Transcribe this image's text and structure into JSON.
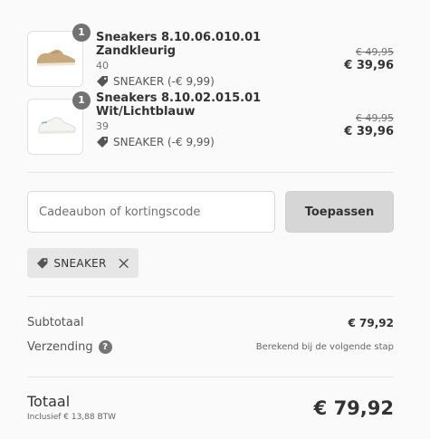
{
  "cart": {
    "items": [
      {
        "quantity": "1",
        "name": "Sneakers 8.10.06.010.01 Zandkleurig",
        "size": "40",
        "discount": "SNEAKER (-€ 9,99)",
        "price_old": "€ 49,95",
        "price_new": "€ 39,96",
        "image_color": "#c8a97e"
      },
      {
        "quantity": "1",
        "name": "Sneakers 8.10.02.015.01 Wit/Lichtblauw",
        "size": "39",
        "discount": "SNEAKER (-€ 9,99)",
        "price_old": "€ 49,95",
        "price_new": "€ 39,96",
        "image_color": "#f2f2ef"
      }
    ]
  },
  "discount_form": {
    "placeholder": "Cadeaubon of kortingscode",
    "value": "",
    "apply_label": "Toepassen",
    "applied_code": "SNEAKER"
  },
  "summary": {
    "subtotal_label": "Subtotaal",
    "subtotal_value": "€ 79,92",
    "shipping_label": "Verzending",
    "shipping_value": "Berekend bij de volgende stap",
    "total_label": "Totaal",
    "total_tax_note": "Inclusief € 13,88 BTW",
    "total_value": "€ 79,92"
  }
}
